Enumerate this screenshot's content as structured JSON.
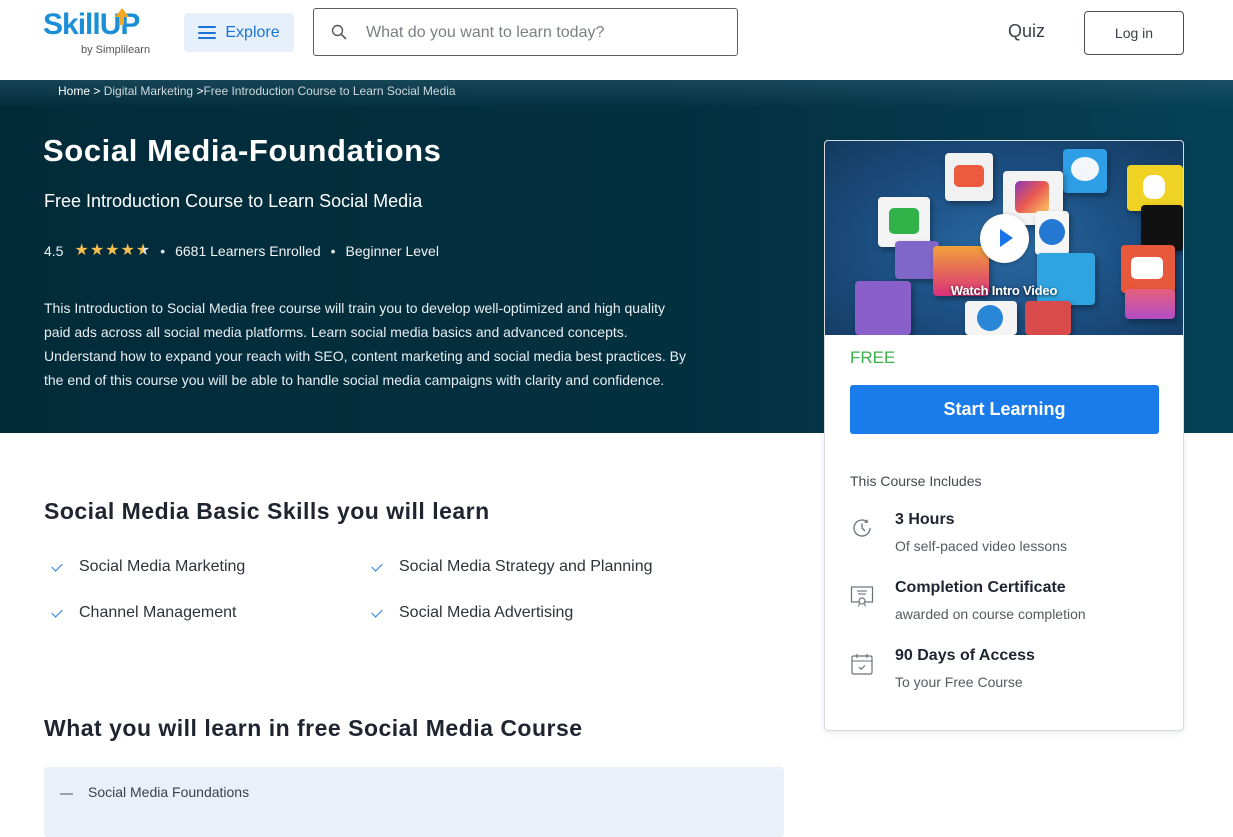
{
  "header": {
    "logo_text": "SkillUP",
    "logo_sub": "by Simplilearn",
    "explore_label": "Explore",
    "search_placeholder": "What do you want to learn today?",
    "search_value": "",
    "quiz_label": "Quiz",
    "login_label": "Log in"
  },
  "breadcrumb": {
    "items": [
      "Home",
      "Digital Marketing",
      "Free Introduction Course to Learn Social Media"
    ],
    "separator": ">"
  },
  "hero": {
    "title": "Social Media-Foundations",
    "subtitle": "Free Introduction Course to Learn Social Media",
    "rating": "4.5",
    "rating_value": 4.5,
    "rating_max": 5,
    "learners": "6681 Learners Enrolled",
    "level": "Beginner Level",
    "description": "This Introduction to Social Media free course will train you to develop well-optimized and high quality paid ads across all social media platforms. Learn social media basics and advanced concepts. Understand how to expand your reach with SEO, content marketing and social media best practices. By the end of this course you will be able to handle social media campaigns with clarity and confidence."
  },
  "card": {
    "video_label": "Watch Intro Video",
    "price": "FREE",
    "cta_label": "Start Learning",
    "includes_title": "This Course Includes",
    "includes": [
      {
        "icon": "clock-icon",
        "title": "3 Hours",
        "subtitle": "Of self-paced video lessons"
      },
      {
        "icon": "certificate-icon",
        "title": "Completion Certificate",
        "subtitle": "awarded on course completion"
      },
      {
        "icon": "calendar-icon",
        "title": "90 Days of Access",
        "subtitle": "To your Free Course"
      }
    ]
  },
  "skills": {
    "heading": "Social Media Basic Skills you will learn",
    "items": [
      "Social Media Marketing",
      "Social Media Strategy and Planning",
      "Channel Management",
      "Social Media Advertising"
    ]
  },
  "curriculum": {
    "heading": "What you will learn in free Social Media Course",
    "modules": [
      {
        "label": "Social Media Foundations",
        "expanded": true
      }
    ]
  },
  "colors": {
    "brand_blue": "#1a8fd8",
    "accent_orange": "#f5a623",
    "cta_blue": "#1a7bea",
    "free_green": "#3cb04a",
    "hero_bg": "#022b3a",
    "star_gold": "#f5c04e"
  }
}
